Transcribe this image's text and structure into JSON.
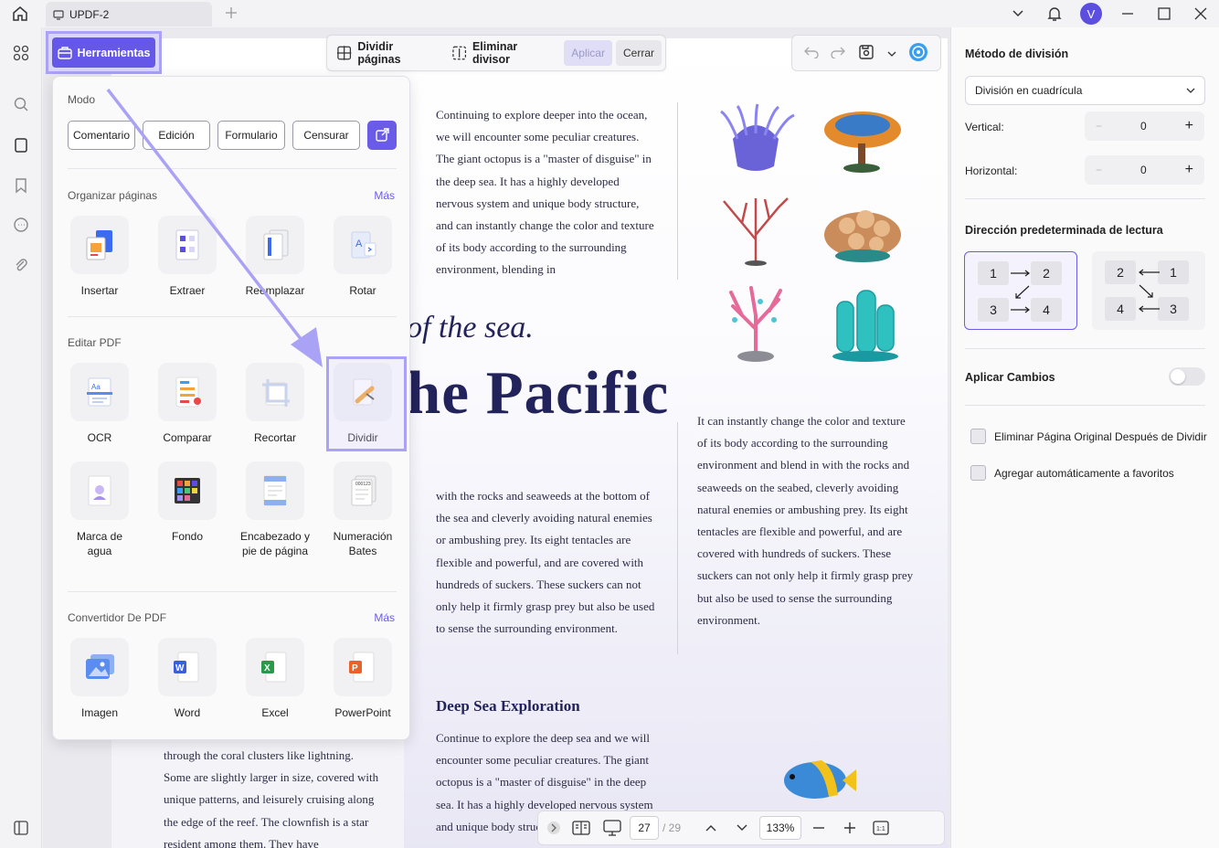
{
  "window": {
    "tab_title": "UPDF-2",
    "avatar_letter": "V"
  },
  "toolbar": {
    "tools_label": "Herramientas",
    "split_pages": "Dividir páginas",
    "remove_divider": "Eliminar divisor",
    "apply": "Aplicar",
    "close": "Cerrar"
  },
  "popup": {
    "mode_title": "Modo",
    "modes": [
      "Comentario",
      "Edición",
      "Formulario",
      "Censurar"
    ],
    "organize_title": "Organizar páginas",
    "organize_more": "Más",
    "organize_tools": [
      "Insertar",
      "Extraer",
      "Reemplazar",
      "Rotar"
    ],
    "edit_title": "Editar PDF",
    "edit_tools": [
      "OCR",
      "Comparar",
      "Recortar",
      "Dividir",
      "Marca de agua",
      "Fondo",
      "Encabezado y pie de página",
      "Numeración Bates"
    ],
    "converter_title": "Convertidor De PDF",
    "converter_more": "Más",
    "converter_tools": [
      "Imagen",
      "Word",
      "Excel",
      "PowerPoint"
    ]
  },
  "doc": {
    "col_top": "Continuing to explore deeper into the ocean, we will encounter some peculiar creatures. The giant octopus is a \"master of disguise\" in the deep sea. It has a highly developed nervous system and unique body structure, and can instantly change the color and texture of its body according to the surrounding environment, blending in",
    "subtitle": "of the sea.",
    "big_title": "he Pacific",
    "col_mid_left": "with the rocks and seaweeds at the bottom of the sea and cleverly avoiding natural enemies or ambushing prey. Its eight tentacles are flexible and powerful, and are covered with hundreds of suckers. These suckers can not only help it firmly grasp prey but also be used to sense the surrounding environment.",
    "col_mid_right": "It can instantly change the color and texture of its body according to the surrounding environment and blend in with the rocks and seaweeds on the seabed, cleverly avoiding natural enemies or ambushing prey. Its eight tentacles are flexible and powerful, and are covered with hundreds of suckers. These suckers can not only help it firmly grasp prey but also be used to sense the surrounding environment.",
    "section_title": "Deep Sea Exploration",
    "col_bottom": "Continue to explore the deep sea and we will encounter some peculiar creatures. The giant octopus is a \"master of disguise\" in the deep sea. It has a highly developed nervous system and unique body structure",
    "col_bottom_left": "through the coral clusters like lightning. Some are slightly larger in size, covered with unique patterns, and leisurely cruising along the edge of the reef. The clownfish is a star resident among them. They have"
  },
  "nav": {
    "current_page": "27",
    "total_pages": "/ 29",
    "zoom": "133%"
  },
  "panel": {
    "method_title": "Método de división",
    "method_value": "División en cuadrícula",
    "vertical_label": "Vertical:",
    "vertical_value": "0",
    "horizontal_label": "Horizontal:",
    "horizontal_value": "0",
    "reading_title": "Dirección predeterminada de lectura",
    "ltr_cells": [
      "1",
      "2",
      "3",
      "4"
    ],
    "rtl_cells": [
      "2",
      "1",
      "4",
      "3"
    ],
    "apply_changes": "Aplicar Cambios",
    "delete_original": "Eliminar Página Original Después de Dividir",
    "add_favorites": "Agregar automáticamente a favoritos"
  },
  "colors": {
    "accent": "#6558e8",
    "highlight": "#a9a2f5",
    "title_navy": "#23235b"
  }
}
